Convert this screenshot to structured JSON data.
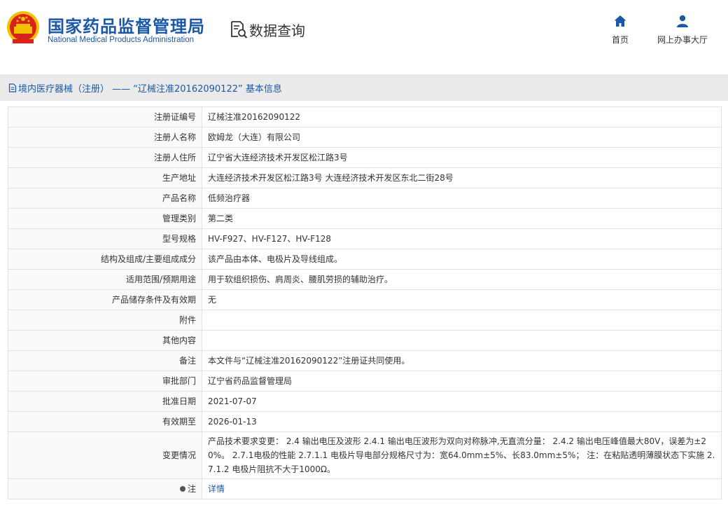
{
  "header": {
    "org_name_cn": "国家药品监督管理局",
    "org_name_en": "National Medical Products Administration",
    "search_label": "数据查询",
    "nav": [
      {
        "label": "首页",
        "icon": "home-icon"
      },
      {
        "label": "网上办事大厅",
        "icon": "user-icon"
      }
    ]
  },
  "breadcrumb": {
    "text": "境内医疗器械（注册） —— “辽械注准20162090122” 基本信息"
  },
  "colors": {
    "brand_blue": "#1b58a8",
    "emblem_red": "#d7231b",
    "emblem_gold": "#f2c200"
  },
  "fields": [
    {
      "label": "注册证编号",
      "value": "辽械注准20162090122"
    },
    {
      "label": "注册人名称",
      "value": "欧姆龙（大连）有限公司"
    },
    {
      "label": "注册人住所",
      "value": "辽宁省大连经济技术开发区松江路3号"
    },
    {
      "label": "生产地址",
      "value": "大连经济技术开发区松江路3号 大连经济技术开发区东北二街28号"
    },
    {
      "label": "产品名称",
      "value": "低频治疗器"
    },
    {
      "label": "管理类别",
      "value": "第二类"
    },
    {
      "label": "型号规格",
      "value": "HV-F927、HV-F127、HV-F128"
    },
    {
      "label": "结构及组成/主要组成成分",
      "value": "该产品由本体、电极片及导线组成。"
    },
    {
      "label": "适用范围/预期用途",
      "value": "用于软组织损伤、肩周炎、腰肌劳损的辅助治疗。"
    },
    {
      "label": "产品储存条件及有效期",
      "value": "无"
    },
    {
      "label": "附件",
      "value": ""
    },
    {
      "label": "其他内容",
      "value": ""
    },
    {
      "label": "备注",
      "value": "本文件与“辽械注准20162090122”注册证共同使用。"
    },
    {
      "label": "审批部门",
      "value": "辽宁省药品监督管理局"
    },
    {
      "label": "批准日期",
      "value": "2021-07-07"
    },
    {
      "label": "有效期至",
      "value": "2026-01-13"
    },
    {
      "label": "变更情况",
      "value": "产品技术要求变更： 2.4 输出电压及波形 2.4.1 输出电压波形为双向对称脉冲,无直流分量： 2.4.2 输出电压峰值最大80V，误差为±20%。 2.7.1电极的性能 2.7.1.1 电极片导电部分规格尺寸为：宽64.0mm±5%、长83.0mm±5%； 注：在粘贴透明薄膜状态下实施 2.7.1.2 电极片阻抗不大于1000Ω。"
    }
  ],
  "note_row": {
    "label": "注",
    "link_text": "详情"
  }
}
